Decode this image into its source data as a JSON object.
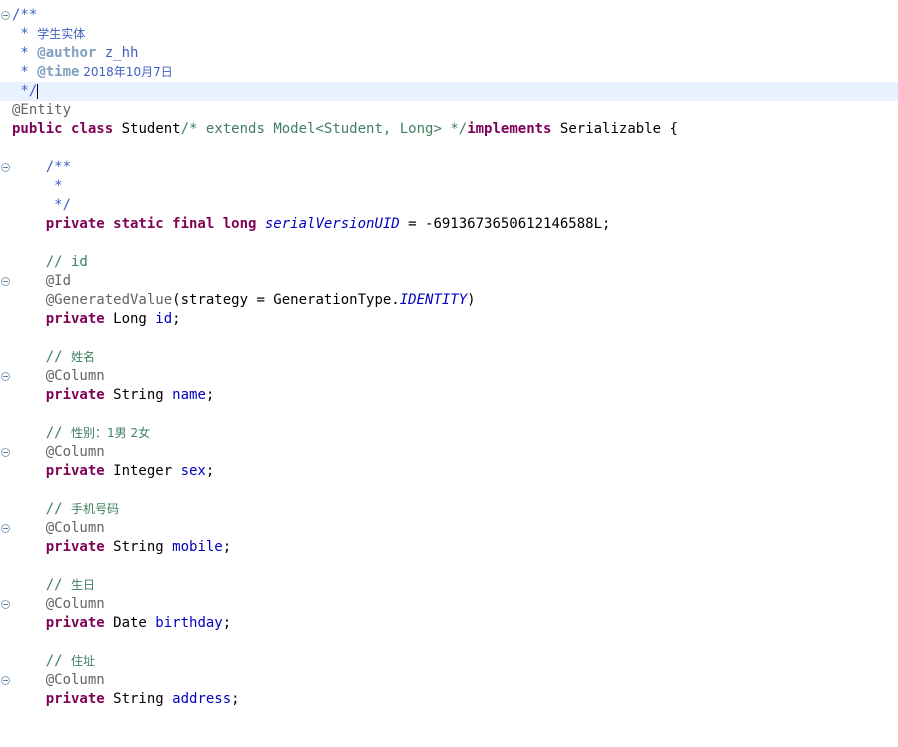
{
  "editor": {
    "header_doc": {
      "open": "/**",
      "line1_star": " * ",
      "line1_text": "学生实体",
      "line2_star": " * ",
      "line2_tag": "@author",
      "line2_val": " z_hh",
      "line3_star": " * ",
      "line3_tag": "@time",
      "line3_val": " 2018年10月7日",
      "close": " */"
    },
    "entity_annotation": "@Entity",
    "class_decl": {
      "kw1": "public",
      "kw2": "class",
      "name": " Student",
      "comment": "/* extends Model<Student, Long> */",
      "kw3": "implements",
      "iface": " Serializable {"
    },
    "field_doc": {
      "open": "    /**",
      "star": "     *",
      "close": "     */"
    },
    "serial": {
      "kw": "    private static final long ",
      "name": "serialVersionUID",
      "rest": " = -6913673650612146588L;"
    },
    "id_block": {
      "comment": "    // id",
      "ann1": "    @Id",
      "ann2": "    @GeneratedValue",
      "ann2_args": "(strategy = GenerationType.",
      "ann2_const": "IDENTITY",
      "ann2_end": ")",
      "kw": "    private",
      "type": " Long ",
      "name": "id",
      "end": ";"
    },
    "fields": [
      {
        "comment_prefix": "    // ",
        "comment": "姓名",
        "ann": "    @Column",
        "kw": "    private",
        "type": " String ",
        "name": "name",
        "end": ";"
      },
      {
        "comment_prefix": "    // ",
        "comment": "性别：1男 2女",
        "ann": "    @Column",
        "kw": "    private",
        "type": " Integer ",
        "name": "sex",
        "end": ";"
      },
      {
        "comment_prefix": "    // ",
        "comment": "手机号码",
        "ann": "    @Column",
        "kw": "    private",
        "type": " String ",
        "name": "mobile",
        "end": ";"
      },
      {
        "comment_prefix": "    // ",
        "comment": "生日",
        "ann": "    @Column",
        "kw": "    private",
        "type": " Date ",
        "name": "birthday",
        "end": ";"
      },
      {
        "comment_prefix": "    // ",
        "comment": "住址",
        "ann": "    @Column",
        "kw": "    private",
        "type": " String ",
        "name": "address",
        "end": ";"
      }
    ]
  }
}
